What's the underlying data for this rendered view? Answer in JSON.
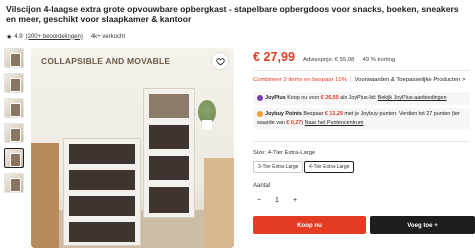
{
  "product": {
    "title": "Vilscijon 4-laagse extra grote opvouwbare opbergkast - stapelbare opbergdoos voor snacks, boeken, sneakers en meer, geschikt voor slaapkamer & kantoor",
    "rating": "4.9",
    "reviews": "(200+ beoordelingen)",
    "sold": "4k+ verkocht"
  },
  "image": {
    "overlay_text": "COLLAPSIBLE AND MOVABLE",
    "thumb_count": 6,
    "active_thumb": 5
  },
  "pricing": {
    "price": "€ 27,99",
    "advies": "Adviesprijs: € 55,08",
    "korting": "49 % korting"
  },
  "combine": {
    "offer": "Combineer 2 items en bespaar 10%",
    "terms": "Voorwaarden & Toepasselijke Producten >"
  },
  "joyplus": {
    "brand": "JoyPlus",
    "text_prefix": "Koop nu voor",
    "amount": "€ 26,59",
    "text_suffix": "als JoyPlus-lid:",
    "link": "Bekijk JoyPlus-aanbiedingen"
  },
  "joypoints": {
    "brand": "Joybuy Points",
    "text_prefix": "Bespaar",
    "amount": "€ 13,29",
    "text_mid": "met je Joybuy-punten: Verdien tot 27 punten (ter waarde van",
    "amount2": "€ 0,27",
    "text_after": ")",
    "link": "Naar het Puntencentrum"
  },
  "size": {
    "label": "Size: 4-Tier Extra-Large",
    "options": [
      "3-Tier Extra-Large",
      "4-Tier Extra-Large"
    ],
    "selected": "4-Tier Extra-Large"
  },
  "quantity": {
    "label": "Aantal",
    "value": "1",
    "minus": "−",
    "plus": "+"
  },
  "actions": {
    "cart": "Koop nu",
    "buy": "Voeg toe +"
  },
  "colors": {
    "accent": "#e43c23",
    "dark": "#1e1e1e"
  }
}
